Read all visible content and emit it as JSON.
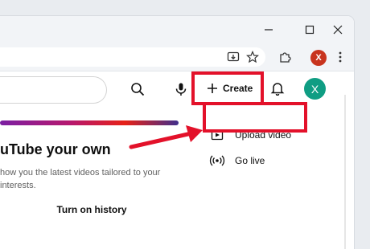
{
  "profile": {
    "initial": "X",
    "avatar_color": "#0f9d83",
    "badge_color": "#c8341e"
  },
  "header": {
    "create_label": "Create"
  },
  "menu": {
    "items": [
      {
        "label": "Upload video",
        "icon": "upload-video-icon"
      },
      {
        "label": "Go live",
        "icon": "live-broadcast-icon"
      }
    ]
  },
  "promo": {
    "headline": "uTube your own",
    "description": "how you the latest videos tailored to your interests.",
    "history_button": "Turn on history"
  },
  "colors": {
    "highlight": "#e3112a",
    "accent_gradient": [
      "#7b1fa2",
      "#b7186d",
      "#e62117",
      "#3f2e8c"
    ]
  }
}
